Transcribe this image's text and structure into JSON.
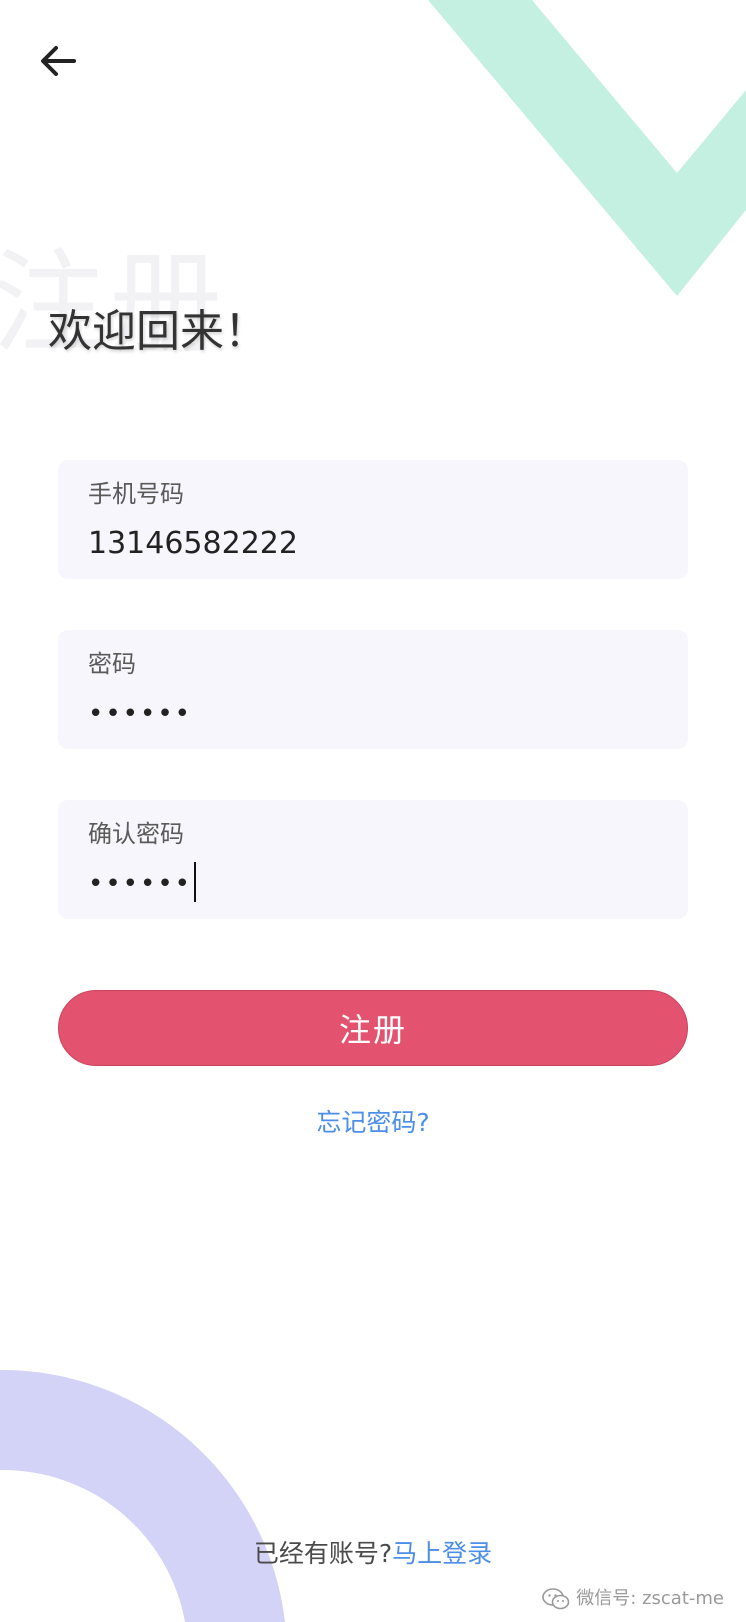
{
  "header": {
    "back_icon": "arrow-left-icon",
    "watermark_text": "注册",
    "title": "欢迎回来！"
  },
  "form": {
    "phone": {
      "label": "手机号码",
      "value": "13146582222"
    },
    "password": {
      "label": "密码",
      "value": "••••••"
    },
    "confirm_password": {
      "label": "确认密码",
      "value": "••••••"
    }
  },
  "actions": {
    "register_label": "注册",
    "forgot_label": "忘记密码?"
  },
  "footer": {
    "prompt": "已经有账号?",
    "login_link": "马上登录"
  },
  "watermark": {
    "icon": "wechat-icon",
    "text": "微信号: zscat-me"
  },
  "colors": {
    "primary_button": "#e3536f",
    "link": "#4c8ee8",
    "field_background": "#f7f6fc",
    "deco_mint": "#c4f0e2",
    "deco_lavender": "#d3d2f7"
  }
}
